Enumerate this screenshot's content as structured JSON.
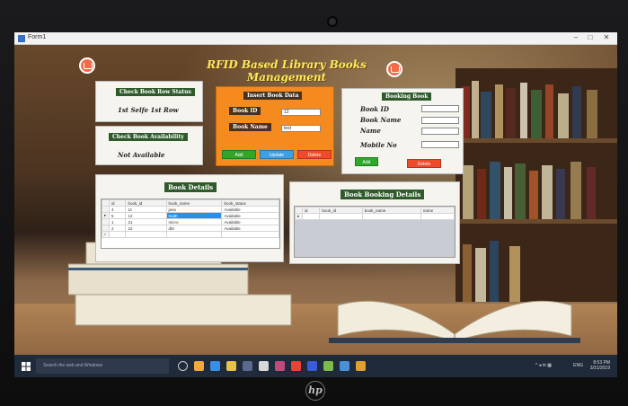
{
  "window": {
    "title": "Form1"
  },
  "heading": "RFID Based Library Books Management",
  "check_status": {
    "title": "Check Book Row Status",
    "value": "1st Selfe 1st Row"
  },
  "check_availability": {
    "title": "Check Book Availability",
    "value": "Not Available"
  },
  "insert": {
    "title": "Insert Book Data",
    "book_id_label": "Book ID",
    "book_id_value": "12",
    "book_name_label": "Book Name",
    "book_name_value": "text",
    "add": "Add",
    "update": "Update",
    "delete": "Delete"
  },
  "booking": {
    "title": "Booking Book",
    "book_id_label": "Book ID",
    "book_name_label": "Book Name",
    "name_label": "Name",
    "mobile_label": "Mobile No",
    "add": "Add",
    "delete": "Delete"
  },
  "book_details": {
    "title": "Book Details",
    "columns": [
      "id",
      "book_id",
      "book_name",
      "book_status"
    ],
    "rows": [
      [
        "4",
        "11",
        "java",
        "Available"
      ],
      [
        "5",
        "12",
        "math",
        "Available"
      ],
      [
        "1",
        "21",
        "micro",
        "Available"
      ],
      [
        "2",
        "22",
        "dbt",
        "Available"
      ]
    ],
    "selected_row": 1
  },
  "booking_details": {
    "title": "Book Booking Details",
    "columns": [
      "id",
      "book_id",
      "book_name",
      "name"
    ]
  },
  "taskbar": {
    "search_placeholder": "Search the web and Windows",
    "lang": "ENG",
    "time": "8:53 PM",
    "date": "3/31/2019"
  },
  "colors": {
    "insert_panel": "#f58a1f",
    "label_green": "#2f5b2c",
    "add_button": "#2ea82b",
    "update_button": "#3aa0e8",
    "delete_button": "#ee4a2b",
    "heading": "#f4ef5c"
  }
}
